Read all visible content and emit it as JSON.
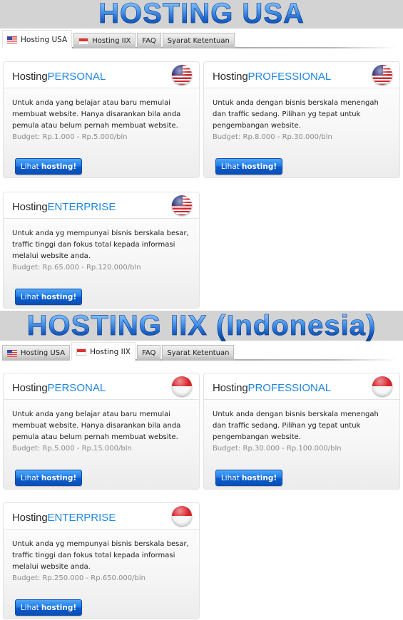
{
  "sections": {
    "usa": {
      "banner_title": "HOSTING USA",
      "tabs": [
        {
          "label": "Hosting USA",
          "icon": "usa-flag-icon",
          "active": true
        },
        {
          "label": "Hosting IIX",
          "icon": "indonesia-flag-icon",
          "active": false
        },
        {
          "label": "FAQ",
          "active": false
        },
        {
          "label": "Syarat Ketentuan",
          "active": false
        }
      ],
      "cards": [
        {
          "title_lead": "Hosting",
          "title_tier": "PERSONAL",
          "flag_icon": "usa-flag-globe-icon",
          "description": "Untuk anda yang belajar atau baru memulai membuat website. Hanya disarankan bila anda pemula atau belum pernah membuat website.",
          "budget": "Budget: Rp.1.000 - Rp.5.000/bln",
          "button_lead": "Lihat",
          "button_strong": "hosting!"
        },
        {
          "title_lead": "Hosting",
          "title_tier": "PROFESSIONAL",
          "flag_icon": "usa-flag-globe-icon",
          "description": "Untuk anda dengan bisnis berskala menengah dan traffic sedang. Pilihan yg tepat untuk pengembangan website.",
          "budget": "Budget: Rp.8.000 - Rp.30.000/bln",
          "button_lead": "Lihat",
          "button_strong": "hosting!"
        },
        {
          "title_lead": "Hosting",
          "title_tier": "ENTERPRISE",
          "flag_icon": "usa-flag-globe-icon",
          "description": "Untuk anda yg mempunyai bisnis berskala besar, traffic tinggi dan fokus total kepada informasi melalui website anda.",
          "budget": "Budget: Rp.65.000 - Rp.120.000/bln",
          "button_lead": "Lihat",
          "button_strong": "hosting!"
        }
      ]
    },
    "iix": {
      "banner_title": "HOSTING IIX (Indonesia)",
      "tabs": [
        {
          "label": "Hosting USA",
          "icon": "usa-flag-icon",
          "active": false
        },
        {
          "label": "Hosting IIX",
          "icon": "indonesia-flag-icon",
          "active": true
        },
        {
          "label": "FAQ",
          "active": false
        },
        {
          "label": "Syarat Ketentuan",
          "active": false
        }
      ],
      "cards": [
        {
          "title_lead": "Hosting",
          "title_tier": "PERSONAL",
          "flag_icon": "indonesia-flag-globe-icon",
          "description": "Untuk anda yang belajar atau baru memulai membuat website. Hanya disarankan bila anda pemula atau belum pernah membuat website.",
          "budget": "Budget: Rp.5.000 - Rp.15.000/bln",
          "button_lead": "Lihat",
          "button_strong": "hosting!"
        },
        {
          "title_lead": "Hosting",
          "title_tier": "PROFESSIONAL",
          "flag_icon": "indonesia-flag-globe-icon",
          "description": "Untuk anda dengan bisnis berskala menengah dan traffic sedang. Pilihan yg tepat untuk pengembangan website.",
          "budget": "Budget: Rp.30.000 - Rp.100.000/bln",
          "button_lead": "Lihat",
          "button_strong": "hosting!"
        },
        {
          "title_lead": "Hosting",
          "title_tier": "ENTERPRISE",
          "flag_icon": "indonesia-flag-globe-icon",
          "description": "Untuk anda yg mempunyai bisnis berskala besar, traffic tinggi dan fokus total kepada informasi melalui website anda.",
          "budget": "Budget: Rp.250.000 - Rp.650.000/bln",
          "button_lead": "Lihat",
          "button_strong": "hosting!"
        }
      ]
    }
  },
  "colors": {
    "banner_bg": "#d3d3d3",
    "title_blue": "#1a63c9",
    "tier_blue": "#1f86e0",
    "button_blue": "#1e79e6",
    "budget_gray": "#8c8c8c"
  }
}
